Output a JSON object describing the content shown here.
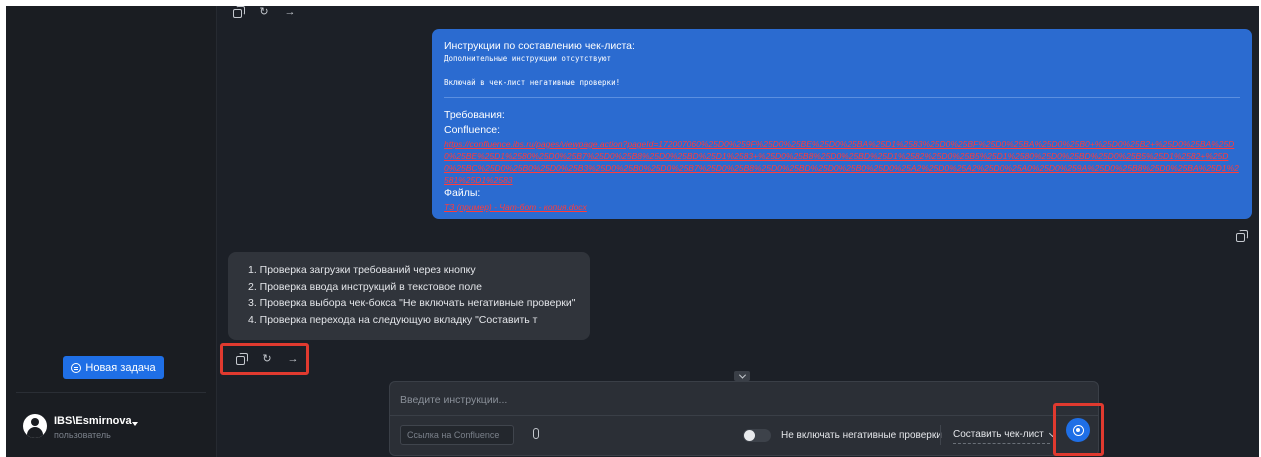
{
  "sidebar": {
    "new_task_label": "Новая задача",
    "user": {
      "name": "IBS\\Esmirnova",
      "role": "пользователь"
    }
  },
  "actions": {
    "copy_icon": "copy-icon",
    "regenerate_icon": "refresh-icon",
    "regenerate_glyph": "↻",
    "continue_icon": "arrow-right-icon",
    "continue_glyph": "→"
  },
  "user_message": {
    "title": "Инструкции по составлению чек-листа:",
    "additional": "Дополнительные инструкции отсутствуют",
    "negative": "Включай в чек-лист негативные проверки!",
    "requirements_label": "Требования:",
    "confluence_label": "Confluence:",
    "confluence_link": "https://confluence.ibs.ru/pages/viewpage.action?pageId=172007060%25D0%259F%25D0%25BE%25D0%25BA%25D1%2583%25D0%25BF%25D0%25BA%25D0%25B0+%25D0%25B2+%25D0%25BA%25D0%25BE%25D1%2580%25D0%25B7%25D0%25B8%25D0%25BD%25D1%2583+%25D0%25B8%25D0%25BD%25D1%2582%25D0%25B5%25D1%2580%25D0%25BD%25D0%25B5%25D1%2582+%25D0%25BC%25D0%25B0%25D0%25B3%25D0%25B0%25D0%25B7%25D0%25B8%25D0%25BD%25D0%25B0%25D0%25A2%25D0%25A2%25D0%25A0%25D0%259A%25D0%25B8%25D0%25BA%25D1%2581%25D1%2583",
    "files_label": "Файлы:",
    "file_link": "ТЗ (пример) - Чат-бот - копия.docx"
  },
  "bot_message": {
    "items": [
      "1. Проверка загрузки требований через кнопку",
      "2. Проверка ввода инструкций в текстовое поле",
      "3. Проверка выбора чек-бокса \"Не включать негативные проверки\"",
      "4. Проверка перехода на следующую вкладку \"Составить т"
    ]
  },
  "input_panel": {
    "instructions_placeholder": "Введите инструкции...",
    "confluence_placeholder": "Ссылка на Confluence",
    "toggle_label": "Не включать негативные проверки",
    "toggle_on": false,
    "mode_value": "Составить чек-лист"
  },
  "colors": {
    "accent": "#1f6fe6",
    "user_bubble": "#2b6bd0",
    "highlight": "#e03a2f",
    "link": "#ff3b3b"
  }
}
